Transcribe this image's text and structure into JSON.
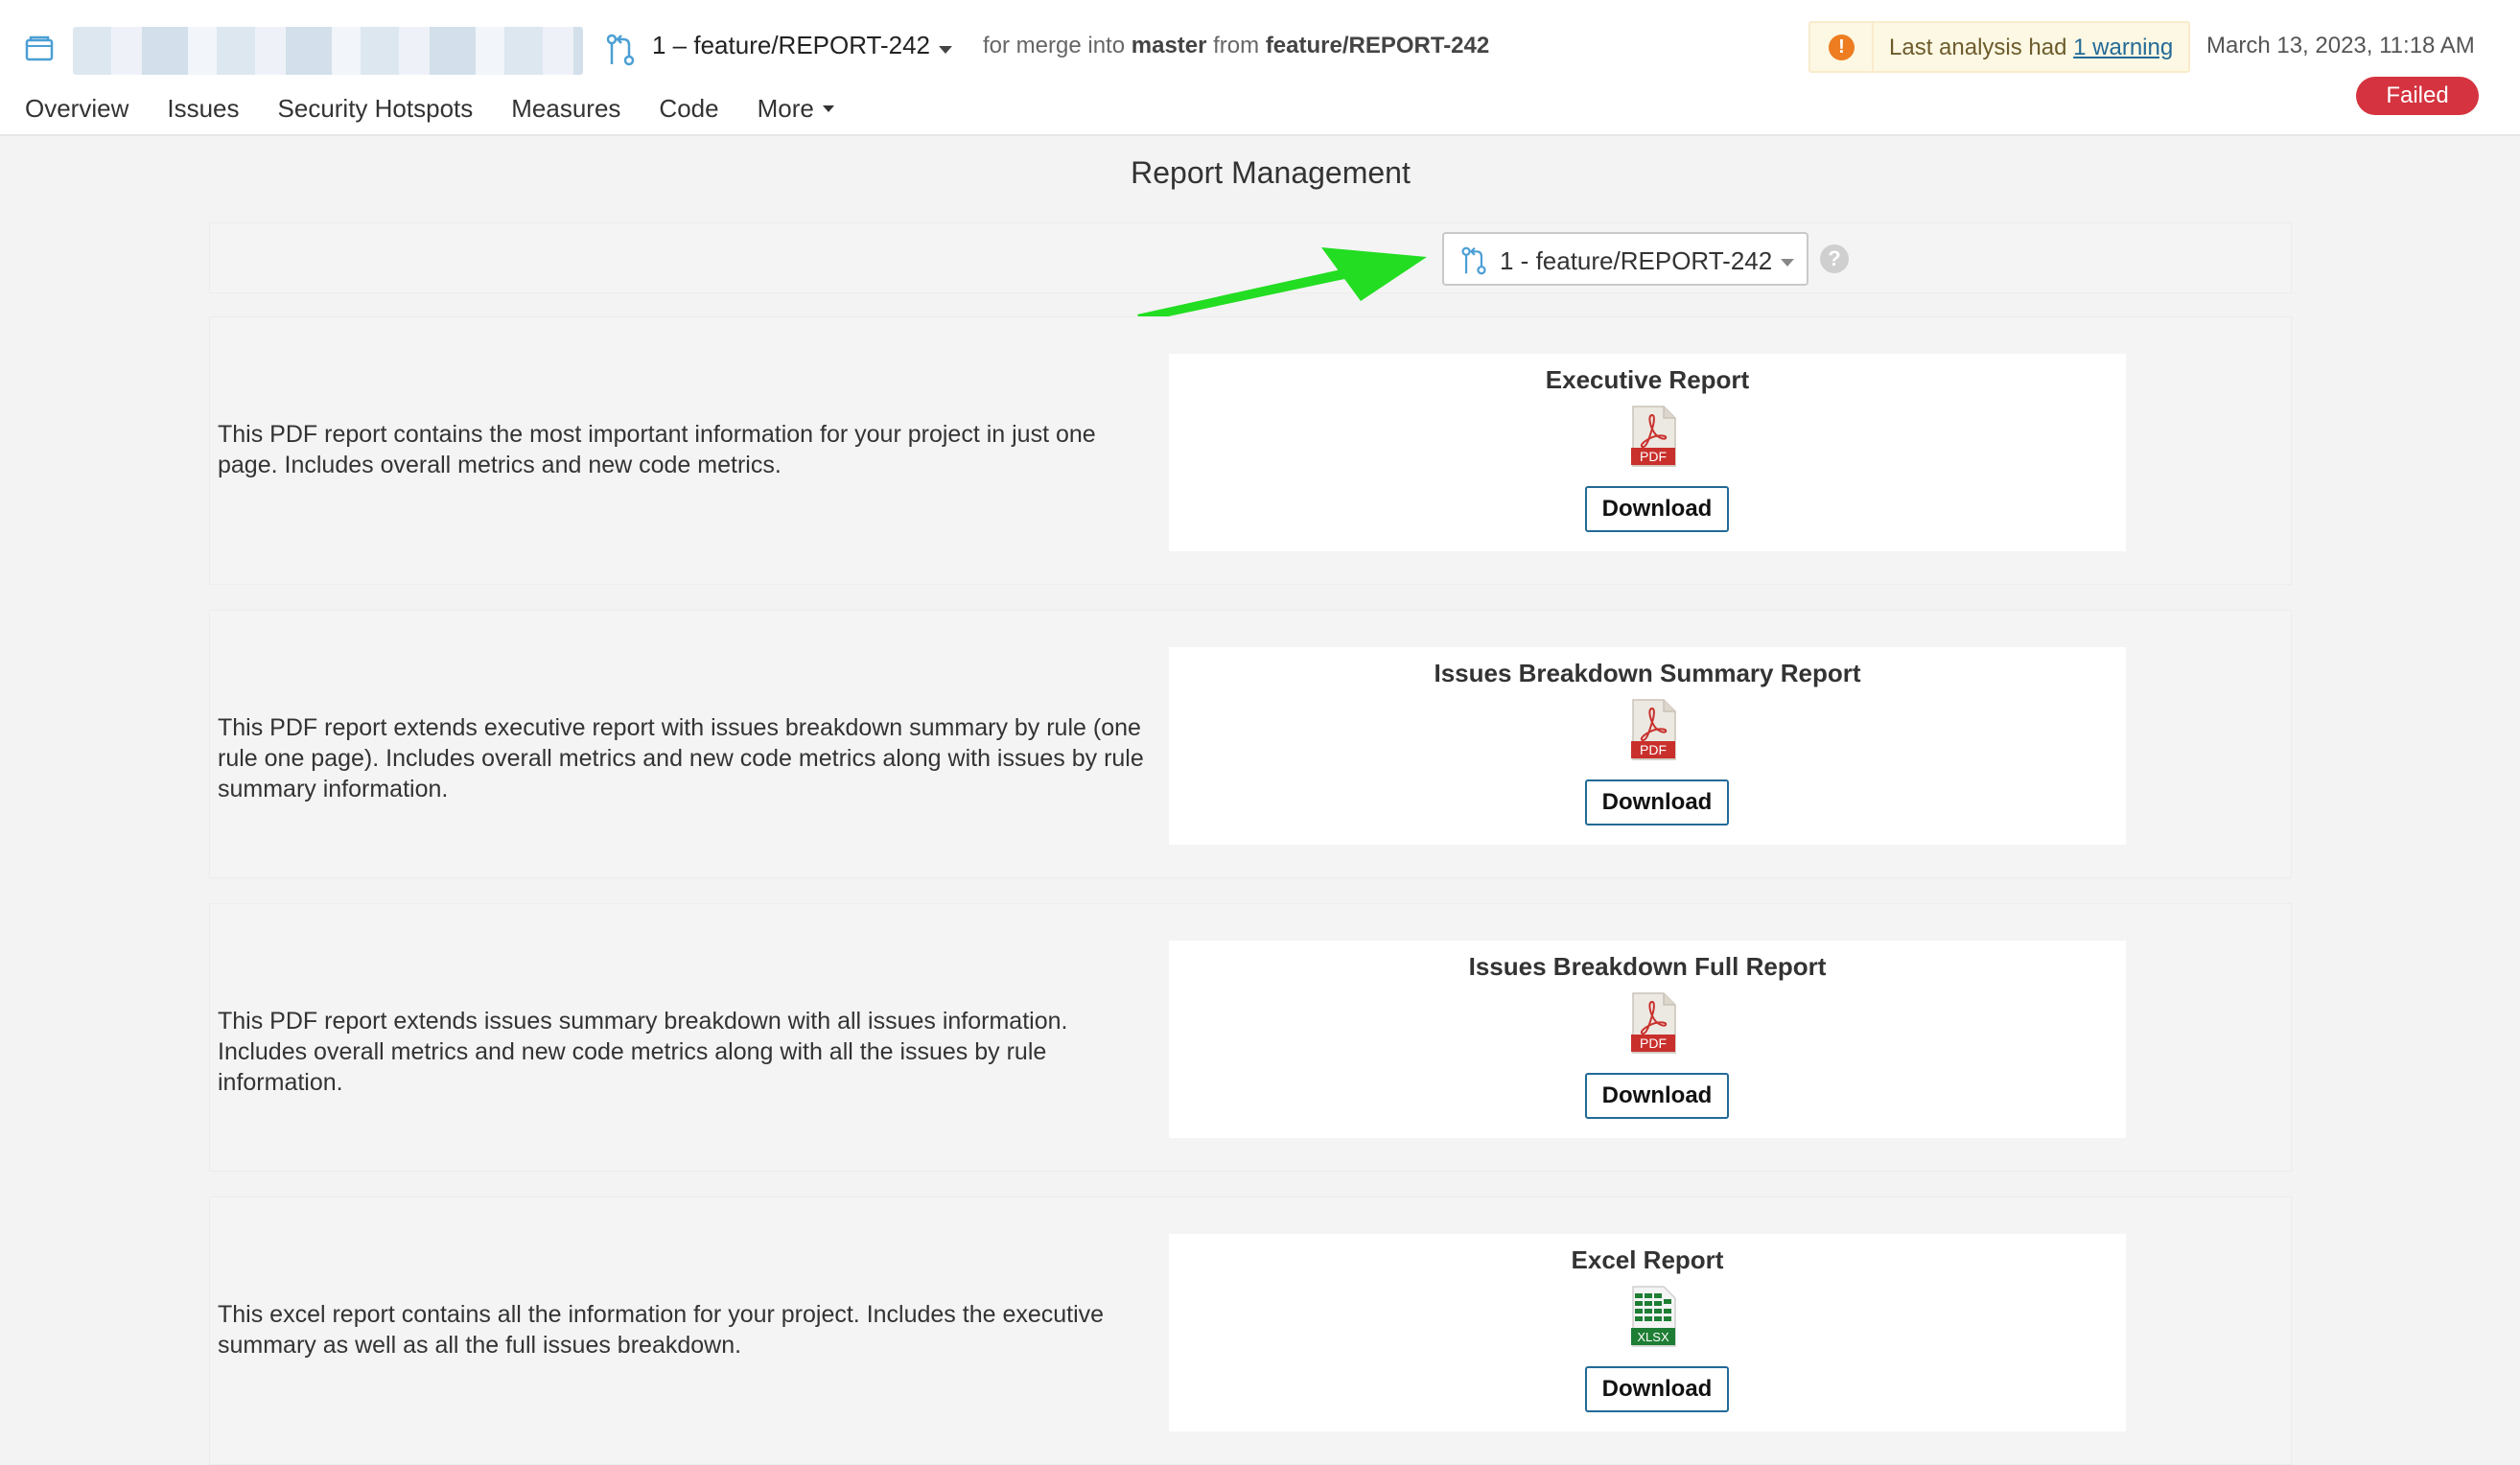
{
  "header": {
    "branch": "1 – feature/REPORT-242",
    "merge_prefix": "for merge into",
    "merge_target": "master",
    "merge_from": "from",
    "merge_source": "feature/REPORT-242",
    "warning_text": "Last analysis had",
    "warning_link": "1 warning",
    "date": "March 13, 2023, 11:18 AM",
    "status": "Failed"
  },
  "nav": {
    "items": [
      "Overview",
      "Issues",
      "Security Hotspots",
      "Measures",
      "Code"
    ],
    "more": "More"
  },
  "page": {
    "title": "Report Management",
    "branch_select": "1 - feature/REPORT-242"
  },
  "reports": [
    {
      "title": "Executive Report",
      "description": "This PDF report contains the most important information for your project in just one page. Includes overall metrics and new code metrics.",
      "file_type": "PDF",
      "download": "Download"
    },
    {
      "title": "Issues Breakdown Summary Report",
      "description": "This PDF report extends executive report with issues breakdown summary by rule (one rule one page). Includes overall metrics and new code metrics along with issues by rule summary information.",
      "file_type": "PDF",
      "download": "Download"
    },
    {
      "title": "Issues Breakdown Full Report",
      "description": "This PDF report extends issues summary breakdown with all issues information. Includes overall metrics and new code metrics along with all the issues by rule information.",
      "file_type": "PDF",
      "download": "Download"
    },
    {
      "title": "Excel Report",
      "description": "This excel report contains all the information for your project. Includes the executive summary as well as all the full issues breakdown.",
      "file_type": "XLSX",
      "download": "Download"
    }
  ],
  "colors": {
    "accent": "#236a97",
    "failed": "#d4333f",
    "warning": "#ed7d20",
    "pdf_red": "#c9302c",
    "xlsx_green": "#1e7e34",
    "arrow_green": "#22dd22"
  }
}
